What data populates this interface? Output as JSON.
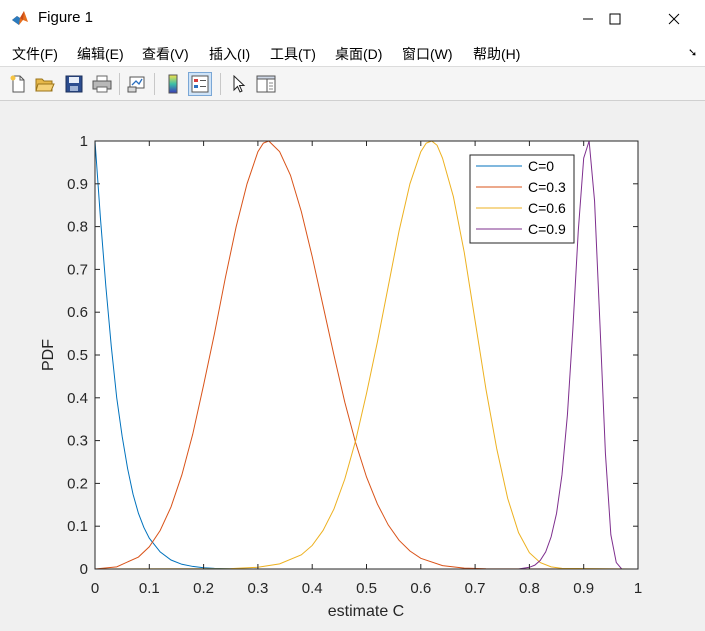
{
  "window": {
    "title": "Figure 1"
  },
  "menu": {
    "items": [
      "文件(F)",
      "编辑(E)",
      "查看(V)",
      "插入(I)",
      "工具(T)",
      "桌面(D)",
      "窗口(W)",
      "帮助(H)"
    ]
  },
  "toolbar": {
    "buttons": [
      {
        "icon": "new-figure-icon"
      },
      {
        "icon": "open-file-icon"
      },
      {
        "icon": "save-icon"
      },
      {
        "icon": "print-icon"
      },
      {
        "icon": "link-plot-icon"
      },
      {
        "icon": "colorbar-icon"
      },
      {
        "icon": "legend-icon",
        "pressed": true
      },
      {
        "icon": "pointer-icon"
      },
      {
        "icon": "property-inspector-icon"
      }
    ]
  },
  "chart_data": {
    "type": "line",
    "title": "",
    "xlabel": "estimate C",
    "ylabel": "PDF",
    "xlim": [
      0,
      1
    ],
    "ylim": [
      0,
      1
    ],
    "xticks": [
      "0",
      "0.1",
      "0.2",
      "0.3",
      "0.4",
      "0.5",
      "0.6",
      "0.7",
      "0.8",
      "0.9",
      "1"
    ],
    "yticks": [
      "0",
      "0.1",
      "0.2",
      "0.3",
      "0.4",
      "0.5",
      "0.6",
      "0.7",
      "0.8",
      "0.9",
      "1"
    ],
    "grid": false,
    "legend_position": "top-right",
    "series": [
      {
        "name": "C=0",
        "color": "#0072bd",
        "x": [
          0,
          0.01,
          0.02,
          0.03,
          0.04,
          0.05,
          0.06,
          0.07,
          0.08,
          0.09,
          0.1,
          0.12,
          0.14,
          0.16,
          0.18,
          0.2,
          0.22,
          0.25,
          0.3,
          0.35,
          1.0
        ],
        "y": [
          1.0,
          0.82,
          0.66,
          0.52,
          0.4,
          0.31,
          0.235,
          0.175,
          0.13,
          0.097,
          0.072,
          0.04,
          0.021,
          0.011,
          0.006,
          0.003,
          0.0015,
          0.0005,
          0.0001,
          0,
          0
        ]
      },
      {
        "name": "C=0.3",
        "color": "#d95319",
        "x": [
          0,
          0.04,
          0.08,
          0.1,
          0.12,
          0.14,
          0.16,
          0.18,
          0.2,
          0.22,
          0.24,
          0.26,
          0.28,
          0.3,
          0.31,
          0.32,
          0.34,
          0.36,
          0.38,
          0.4,
          0.42,
          0.44,
          0.46,
          0.48,
          0.5,
          0.52,
          0.54,
          0.56,
          0.58,
          0.6,
          0.64,
          0.68,
          0.72,
          1.0
        ],
        "y": [
          0.0,
          0.005,
          0.028,
          0.052,
          0.09,
          0.145,
          0.22,
          0.315,
          0.43,
          0.55,
          0.68,
          0.8,
          0.9,
          0.975,
          0.995,
          1.0,
          0.975,
          0.92,
          0.835,
          0.73,
          0.615,
          0.5,
          0.39,
          0.295,
          0.215,
          0.152,
          0.103,
          0.067,
          0.042,
          0.025,
          0.008,
          0.002,
          0.0005,
          0
        ]
      },
      {
        "name": "C=0.6",
        "color": "#edb120",
        "x": [
          0,
          0.25,
          0.3,
          0.34,
          0.38,
          0.4,
          0.42,
          0.44,
          0.46,
          0.48,
          0.5,
          0.52,
          0.54,
          0.56,
          0.58,
          0.6,
          0.61,
          0.62,
          0.63,
          0.64,
          0.66,
          0.68,
          0.7,
          0.72,
          0.74,
          0.76,
          0.78,
          0.8,
          0.82,
          0.84,
          0.86,
          1.0
        ],
        "y": [
          0,
          0.001,
          0.004,
          0.012,
          0.033,
          0.055,
          0.09,
          0.14,
          0.21,
          0.3,
          0.41,
          0.53,
          0.66,
          0.79,
          0.9,
          0.975,
          0.995,
          1.0,
          0.99,
          0.96,
          0.87,
          0.74,
          0.58,
          0.42,
          0.28,
          0.165,
          0.085,
          0.038,
          0.015,
          0.005,
          0.0015,
          0
        ]
      },
      {
        "name": "C=0.9",
        "color": "#7e2f8e",
        "x": [
          0,
          0.78,
          0.8,
          0.81,
          0.82,
          0.83,
          0.84,
          0.85,
          0.86,
          0.87,
          0.88,
          0.89,
          0.9,
          0.91,
          0.92,
          0.93,
          0.94,
          0.95,
          0.96,
          0.97,
          1.0
        ],
        "y": [
          0,
          0.0,
          0.004,
          0.009,
          0.02,
          0.04,
          0.075,
          0.13,
          0.22,
          0.36,
          0.56,
          0.79,
          0.96,
          1.0,
          0.86,
          0.57,
          0.27,
          0.08,
          0.015,
          0.0,
          0
        ]
      }
    ]
  }
}
